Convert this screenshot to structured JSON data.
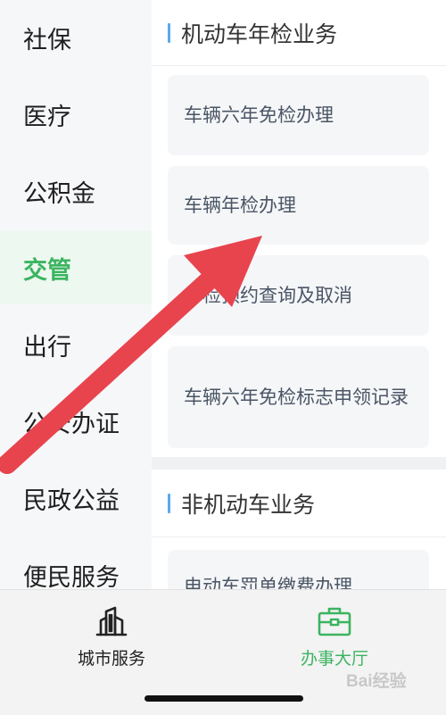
{
  "sidebar": {
    "items": [
      {
        "label": "社保",
        "active": false
      },
      {
        "label": "医疗",
        "active": false
      },
      {
        "label": "公积金",
        "active": false
      },
      {
        "label": "交管",
        "active": true
      },
      {
        "label": "出行",
        "active": false
      },
      {
        "label": "公安办证",
        "active": false
      },
      {
        "label": "民政公益",
        "active": false
      },
      {
        "label": "便民服务",
        "active": false
      }
    ]
  },
  "main": {
    "section1": {
      "title": "机动车年检业务",
      "tiles": [
        "车辆六年免检办理",
        "车辆年检办理",
        "年检预约查询及取消",
        "车辆六年免检标志申领记录"
      ]
    },
    "section2": {
      "title": "非机动车业务",
      "tiles": [
        "电动车罚单缴费办理"
      ]
    }
  },
  "tabbar": {
    "tabs": [
      {
        "label": "城市服务",
        "icon": "city-buildings-icon",
        "active": false
      },
      {
        "label": "办事大厅",
        "icon": "briefcase-icon",
        "active": true
      }
    ]
  },
  "watermark": "Bai经验",
  "colors": {
    "accent_green": "#3cb460",
    "section_bar_blue": "#5aa9ee",
    "arrow_red": "#e8444e"
  }
}
